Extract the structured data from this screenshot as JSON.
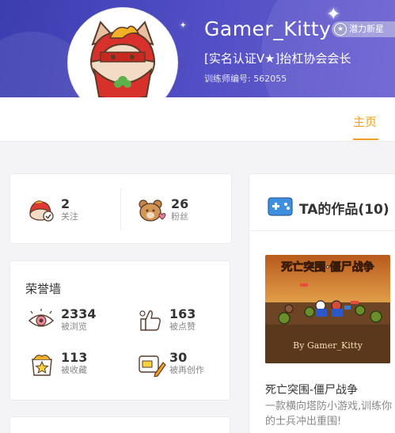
{
  "profile": {
    "username": "Gamer_Kitty",
    "title": "[实名认证V★]抬杠协会会长",
    "trainer_id": "训练师编号: 562055",
    "badge": "潜力新星"
  },
  "tabs": [
    {
      "label": "主页",
      "active": true
    }
  ],
  "follow_stats": [
    {
      "value": "2",
      "label": "关注",
      "icon": "mascot-check-icon"
    },
    {
      "value": "26",
      "label": "粉丝",
      "icon": "bear-heart-icon"
    }
  ],
  "honor": {
    "title": "荣誉墙",
    "stats": [
      {
        "value": "2334",
        "label": "被浏览",
        "icon": "eye-icon"
      },
      {
        "value": "163",
        "label": "被点赞",
        "icon": "thumbs-up-icon"
      },
      {
        "value": "113",
        "label": "被收藏",
        "icon": "star-box-icon"
      },
      {
        "value": "30",
        "label": "被再创作",
        "icon": "remix-icon"
      }
    ]
  },
  "works": {
    "title": "TA的作品(10)",
    "items": [
      {
        "name": "死亡突围-僵尸战争",
        "description": "一款横向塔防小游戏,训练你的士兵冲出重围!",
        "thumbnail_title": "死亡突围·僵尸战争",
        "thumbnail_signature": "By Gamer_Kitty"
      }
    ]
  },
  "colors": {
    "banner": "#4a48bd",
    "accent": "#f0a01c"
  }
}
